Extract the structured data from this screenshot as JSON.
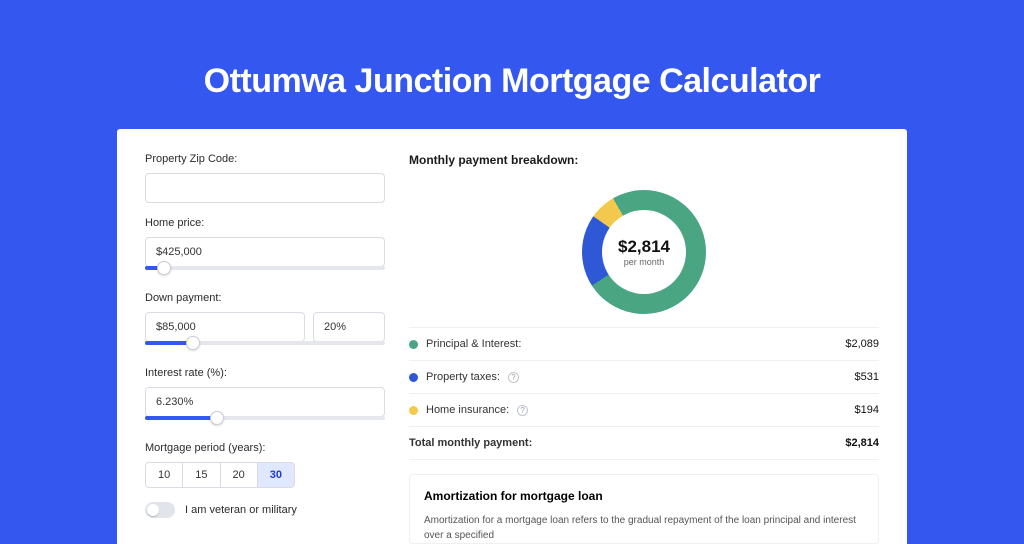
{
  "page": {
    "title": "Ottumwa Junction Mortgage Calculator"
  },
  "form": {
    "zip": {
      "label": "Property Zip Code:",
      "value": ""
    },
    "price": {
      "label": "Home price:",
      "value": "$425,000",
      "slider_pct": 8
    },
    "down": {
      "label": "Down payment:",
      "amount": "$85,000",
      "percent": "20%",
      "slider_pct": 20
    },
    "rate": {
      "label": "Interest rate (%):",
      "value": "6.230%",
      "slider_pct": 30
    },
    "period": {
      "label": "Mortgage period (years):",
      "options": [
        "10",
        "15",
        "20",
        "30"
      ],
      "selected": "30"
    },
    "veteran": {
      "label": "I am veteran or military",
      "checked": false
    }
  },
  "breakdown": {
    "title": "Monthly payment breakdown:",
    "center_value": "$2,814",
    "center_sub": "per month",
    "items": [
      {
        "key": "principal_interest",
        "label": "Principal & Interest:",
        "value": "$2,089",
        "color": "#4aa583",
        "raw": 2089,
        "info": false
      },
      {
        "key": "property_taxes",
        "label": "Property taxes:",
        "value": "$531",
        "color": "#2f58d6",
        "raw": 531,
        "info": true
      },
      {
        "key": "home_insurance",
        "label": "Home insurance:",
        "value": "$194",
        "color": "#f2c94c",
        "raw": 194,
        "info": true
      }
    ],
    "total": {
      "label": "Total monthly payment:",
      "value": "$2,814"
    }
  },
  "amortization": {
    "title": "Amortization for mortgage loan",
    "body": "Amortization for a mortgage loan refers to the gradual repayment of the loan principal and interest over a specified"
  },
  "chart_data": {
    "type": "pie",
    "title": "Monthly payment breakdown",
    "series": [
      {
        "name": "Principal & Interest",
        "value": 2089,
        "color": "#4aa583"
      },
      {
        "name": "Property taxes",
        "value": 531,
        "color": "#2f58d6"
      },
      {
        "name": "Home insurance",
        "value": 194,
        "color": "#f2c94c"
      }
    ],
    "total": 2814,
    "center_label": "$2,814 per month"
  }
}
